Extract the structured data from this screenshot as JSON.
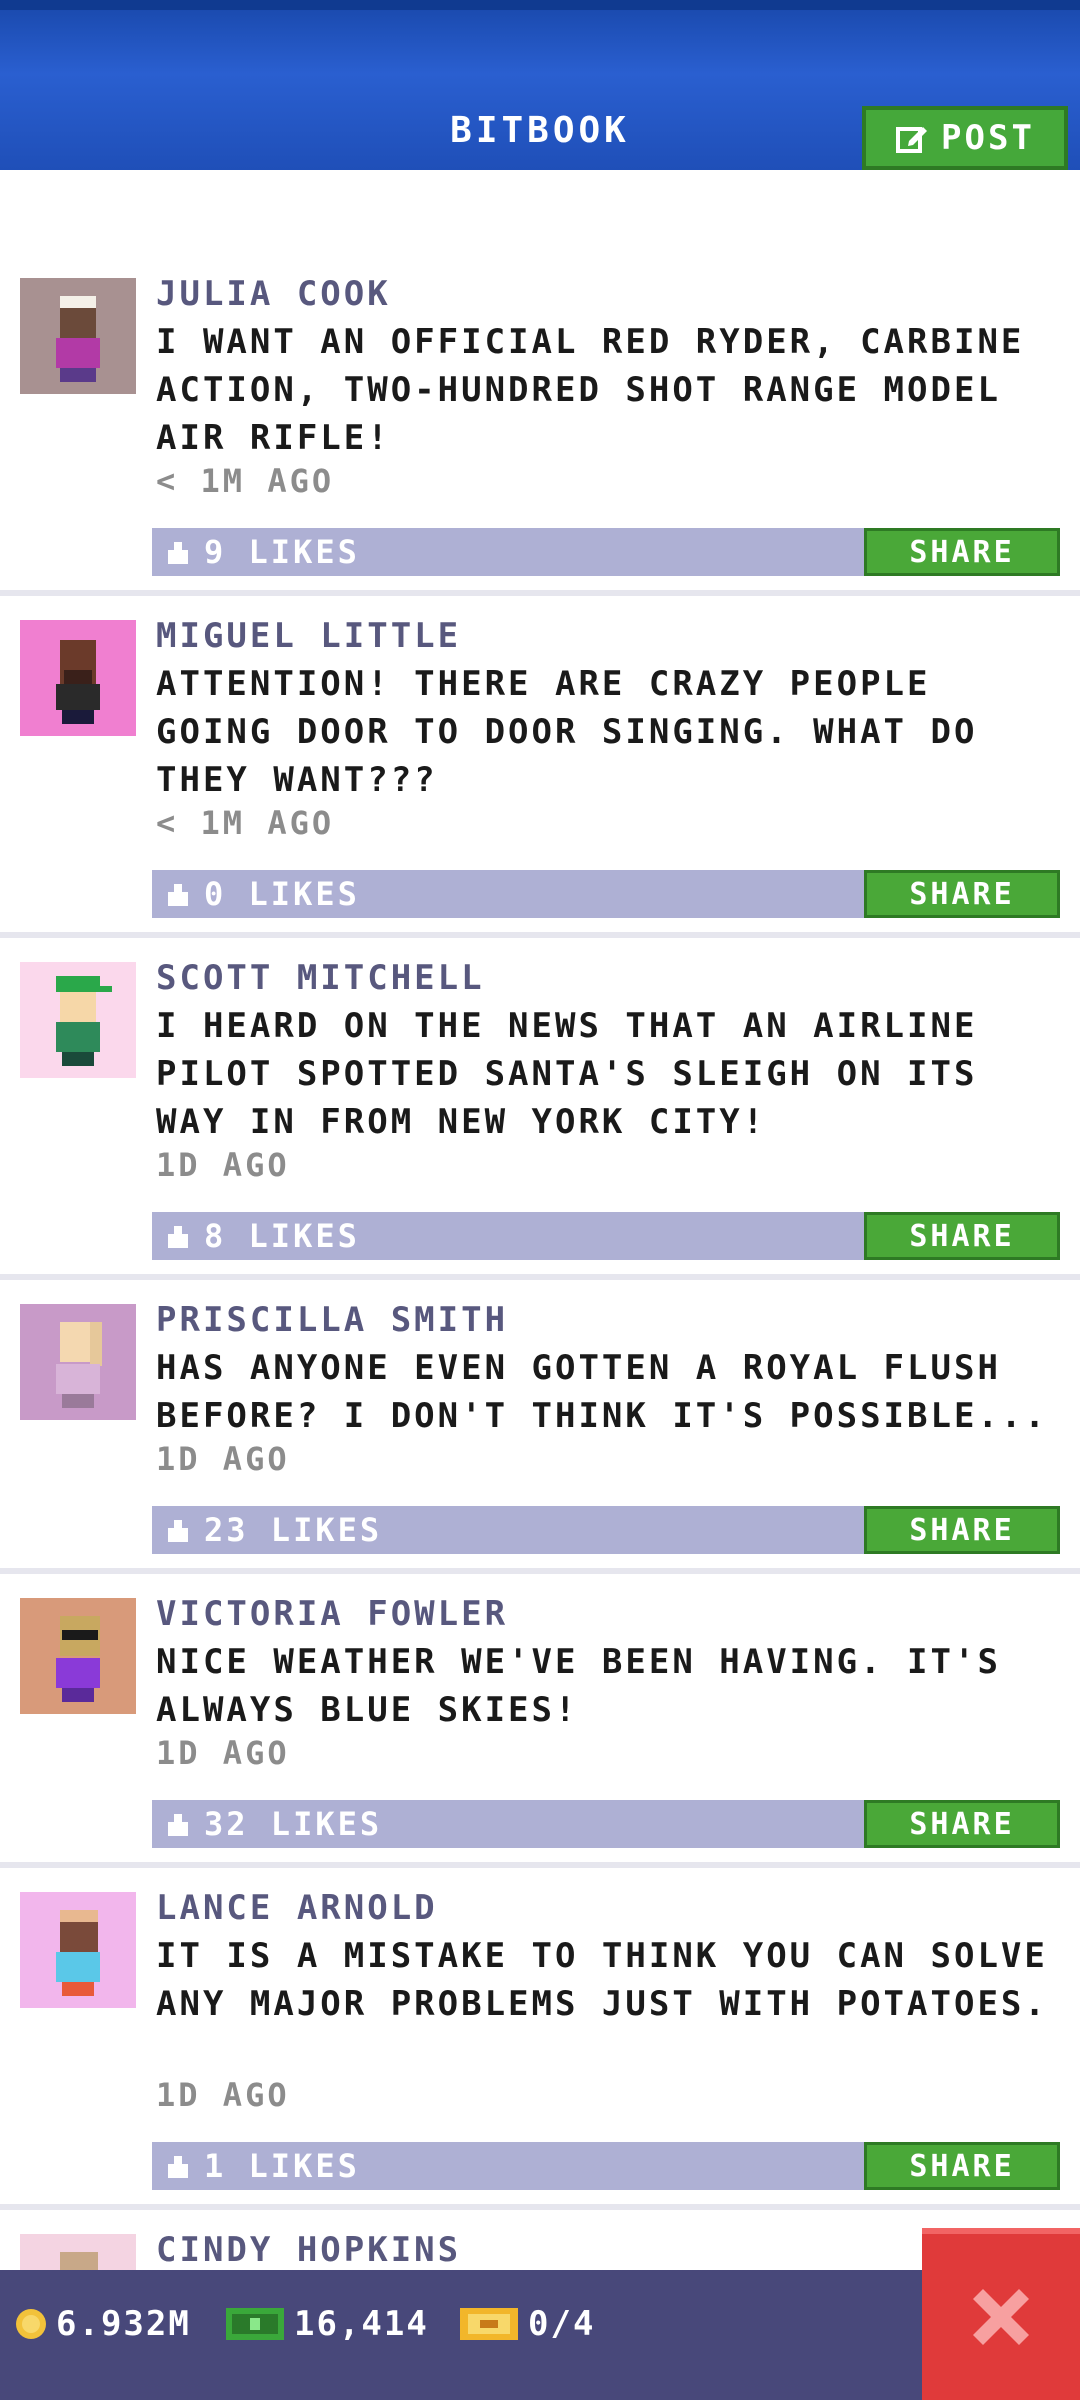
{
  "header": {
    "title": "BITBOOK",
    "post_label": "POST"
  },
  "posts": [
    {
      "author": "JULIA COOK",
      "text": "I WANT AN OFFICIAL RED RYDER, CARBINE ACTION, TWO-HUNDRED SHOT RANGE MODEL AIR RIFLE!",
      "time": "< 1M AGO",
      "likes": "9 LIKES",
      "share": "SHARE",
      "avatar_bg": "#a89191"
    },
    {
      "author": "MIGUEL LITTLE",
      "text": "ATTENTION! THERE ARE CRAZY PEOPLE GOING DOOR TO DOOR SINGING. WHAT DO THEY WANT???",
      "time": "< 1M AGO",
      "likes": "0 LIKES",
      "share": "SHARE",
      "avatar_bg": "#f07fd0"
    },
    {
      "author": "SCOTT MITCHELL",
      "text": "I HEARD ON THE NEWS THAT AN AIRLINE PILOT SPOTTED SANTA'S SLEIGH ON ITS WAY IN FROM NEW YORK CITY!",
      "time": "1D AGO",
      "likes": "8 LIKES",
      "share": "SHARE",
      "avatar_bg": "#fbd8ec"
    },
    {
      "author": "PRISCILLA SMITH",
      "text": "HAS ANYONE EVEN GOTTEN A ROYAL FLUSH BEFORE? I DON'T THINK IT'S POSSIBLE...",
      "time": "1D AGO",
      "likes": "23 LIKES",
      "share": "SHARE",
      "avatar_bg": "#c89ac8"
    },
    {
      "author": "VICTORIA FOWLER",
      "text": "NICE WEATHER WE'VE BEEN HAVING. IT'S ALWAYS BLUE SKIES!",
      "time": "1D AGO",
      "likes": "32 LIKES",
      "share": "SHARE",
      "avatar_bg": "#d89a7a"
    },
    {
      "author": "LANCE ARNOLD",
      "text": "IT IS A MISTAKE TO THINK YOU CAN SOLVE ANY MAJOR PROBLEMS JUST WITH POTATOES.",
      "time": "1D AGO",
      "likes": "1 LIKES",
      "share": "SHARE",
      "avatar_bg": "#f2b6ec"
    },
    {
      "author": "CINDY HOPKINS",
      "avatar_bg": "#f4d4e2"
    }
  ],
  "bottom": {
    "coins": "6.932M",
    "bux": "16,414",
    "tickets": "0/4"
  },
  "colors": {
    "header": "#1f4fb8",
    "green": "#45a83a",
    "likes_bar": "#aeb0d4",
    "bottom_bar": "#48487a",
    "close": "#e03a3a"
  },
  "icons": {
    "post": "edit-icon",
    "like": "thumbs-up-icon",
    "coin": "coin-icon",
    "bux": "bux-icon",
    "ticket": "ticket-icon",
    "close": "close-icon"
  }
}
